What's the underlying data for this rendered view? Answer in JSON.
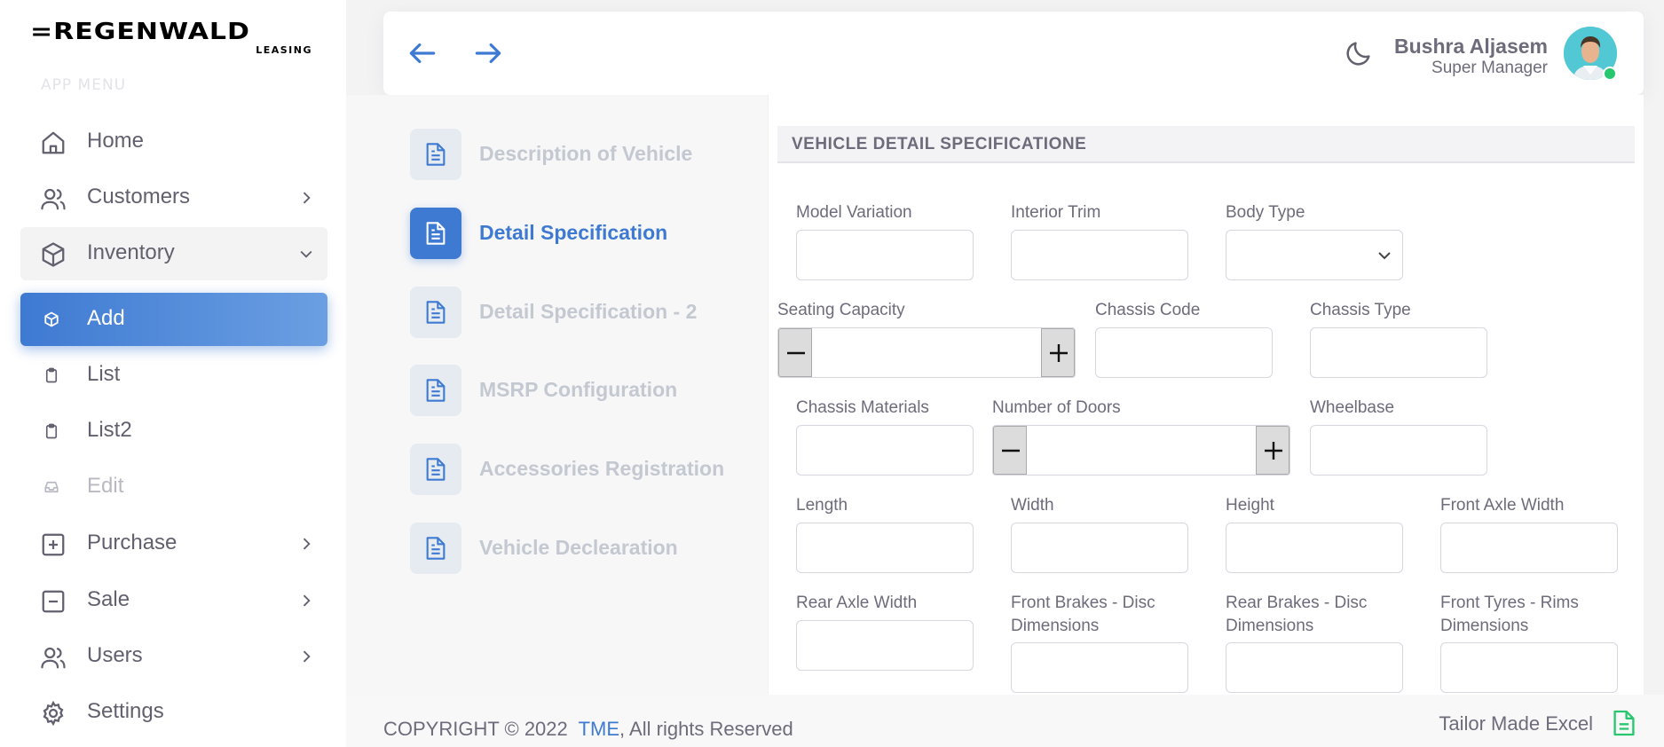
{
  "brand": {
    "logo_main": "=REGENWALD",
    "logo_sub": "LEASING"
  },
  "sidebar": {
    "menu_header": "APP MENU",
    "items": [
      {
        "label": "Home",
        "icon": "home-icon"
      },
      {
        "label": "Customers",
        "icon": "users-icon"
      },
      {
        "label": "Inventory",
        "icon": "box-icon"
      },
      {
        "label": "Add",
        "icon": "cube-icon"
      },
      {
        "label": "List",
        "icon": "clipboard-icon"
      },
      {
        "label": "List2",
        "icon": "clipboard-icon"
      },
      {
        "label": "Edit",
        "icon": "inbox-icon"
      },
      {
        "label": "Purchase",
        "icon": "plus-square-icon"
      },
      {
        "label": "Sale",
        "icon": "minus-square-icon"
      },
      {
        "label": "Users",
        "icon": "users-icon"
      },
      {
        "label": "Settings",
        "icon": "gear-icon"
      }
    ]
  },
  "header": {
    "user_name": "Bushra Aljasem",
    "user_role": "Super Manager",
    "status": "online"
  },
  "steps": [
    {
      "label": "Description of Vehicle",
      "active": false
    },
    {
      "label": "Detail Specification",
      "active": true
    },
    {
      "label": "Detail Specification - 2",
      "active": false
    },
    {
      "label": "MSRP Configuration",
      "active": false
    },
    {
      "label": "Accessories Registration",
      "active": false
    },
    {
      "label": "Vehicle Declearation",
      "active": false
    }
  ],
  "form": {
    "section_title": "VEHICLE DETAIL SPECIFICATIONE",
    "fields": {
      "model_variation": {
        "label": "Model Variation",
        "value": ""
      },
      "interior_trim": {
        "label": "Interior Trim",
        "value": ""
      },
      "body_type": {
        "label": "Body Type",
        "value": ""
      },
      "seating_capacity": {
        "label": "Seating Capacity",
        "value": ""
      },
      "chassis_code": {
        "label": "Chassis Code",
        "value": ""
      },
      "chassis_type": {
        "label": "Chassis Type",
        "value": ""
      },
      "chassis_materials": {
        "label": "Chassis Materials",
        "value": ""
      },
      "number_of_doors": {
        "label": "Number of Doors",
        "value": ""
      },
      "wheelbase": {
        "label": "Wheelbase",
        "value": ""
      },
      "length": {
        "label": "Length",
        "value": ""
      },
      "width": {
        "label": "Width",
        "value": ""
      },
      "height": {
        "label": "Height",
        "value": ""
      },
      "front_axle_width": {
        "label": "Front Axle Width",
        "value": ""
      },
      "rear_axle_width": {
        "label": "Rear Axle Width",
        "value": ""
      },
      "front_brakes": {
        "label": "Front Brakes - Disc Dimensions",
        "value": ""
      },
      "rear_brakes": {
        "label": "Rear Brakes - Disc Dimensions",
        "value": ""
      },
      "front_tyres": {
        "label": "Front Tyres - Rims Dimensions",
        "value": ""
      }
    }
  },
  "footer": {
    "copyright_prefix": "COPYRIGHT © 2022",
    "copyright_link": "TME",
    "copyright_suffix": ", All rights Reserved",
    "brand": "Tailor Made Excel"
  },
  "colors": {
    "accent": "#3e7ad2",
    "online": "#28c76f",
    "excel": "#28c76f"
  }
}
